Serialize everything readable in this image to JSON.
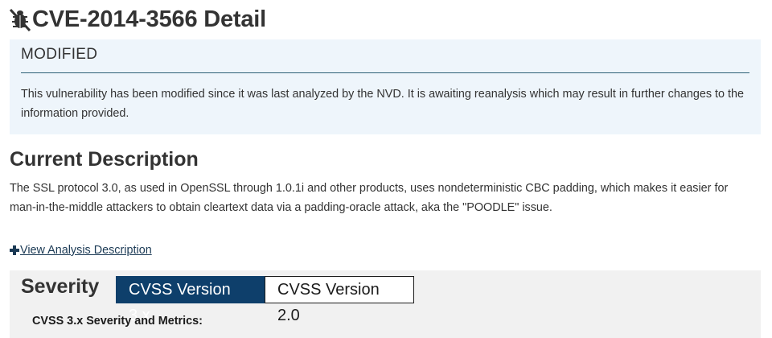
{
  "header": {
    "title": "CVE-2014-3566 Detail",
    "icon": "bug-icon"
  },
  "modified_notice": {
    "heading": "MODIFIED",
    "text": "This vulnerability has been modified since it was last analyzed by the NVD. It is awaiting reanalysis which may result in further changes to the information provided."
  },
  "description": {
    "heading": "Current Description",
    "text": "The SSL protocol 3.0, as used in OpenSSL through 1.0.1i and other products, uses nondeterministic CBC padding, which makes it easier for man-in-the-middle attackers to obtain cleartext data via a padding-oracle attack, aka the \"POODLE\" issue."
  },
  "analysis_link": {
    "label": "View Analysis Description",
    "icon": "plus-icon"
  },
  "severity": {
    "heading": "Severity",
    "tabs": [
      {
        "label": "CVSS Version 3.x",
        "active": true
      },
      {
        "label": "CVSS Version 2.0",
        "active": false
      }
    ],
    "metrics_heading": "CVSS 3.x Severity and Metrics:"
  },
  "colors": {
    "accent": "#0e3f6b",
    "banner_bg": "#eef5fb",
    "panel_bg": "#f1f1f1",
    "link": "#1b3a55"
  }
}
